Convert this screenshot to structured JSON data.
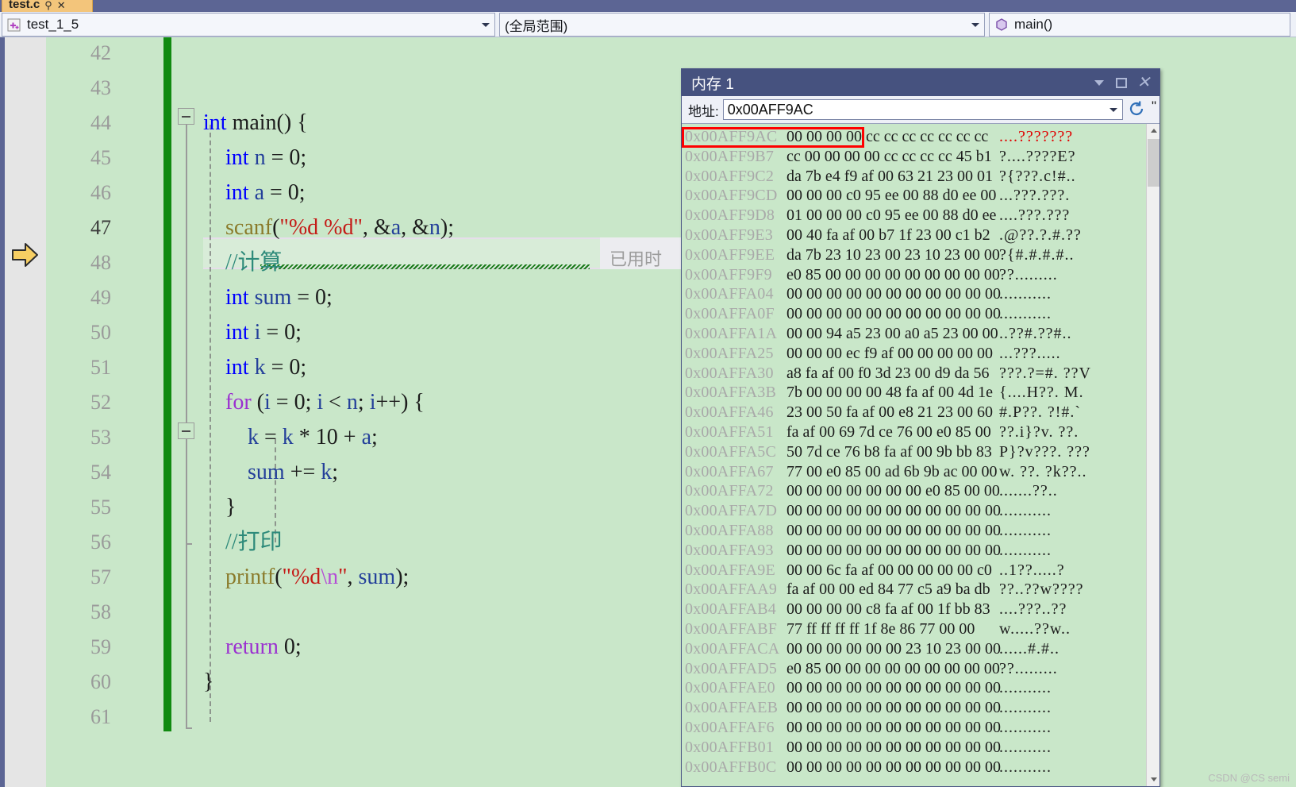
{
  "tab": {
    "title": "test.c",
    "pin_icon": "pin-icon",
    "close_icon": "close-icon"
  },
  "navbar": {
    "project_combo": {
      "value": "test_1_5",
      "icon": "project-icon"
    },
    "scope_combo": {
      "value": "(全局范围)"
    },
    "member_combo": {
      "value": "main()",
      "icon": "method-icon"
    }
  },
  "editor": {
    "current_line": 47,
    "first_line": 42,
    "elapsed_text": "已用时",
    "lines": [
      {
        "n": 42,
        "tokens": []
      },
      {
        "n": 43,
        "tokens": []
      },
      {
        "n": 44,
        "tokens": [
          {
            "t": "int ",
            "c": "kw"
          },
          {
            "t": "main() {",
            "c": "plain"
          }
        ]
      },
      {
        "n": 45,
        "tokens": [
          {
            "t": "    ",
            "c": "plain"
          },
          {
            "t": "int ",
            "c": "kw"
          },
          {
            "t": "n ",
            "c": "var"
          },
          {
            "t": "= ",
            "c": "plain"
          },
          {
            "t": "0",
            "c": "num"
          },
          {
            "t": ";",
            "c": "plain"
          }
        ]
      },
      {
        "n": 46,
        "tokens": [
          {
            "t": "    ",
            "c": "plain"
          },
          {
            "t": "int ",
            "c": "kw"
          },
          {
            "t": "a ",
            "c": "var"
          },
          {
            "t": "= ",
            "c": "plain"
          },
          {
            "t": "0",
            "c": "num"
          },
          {
            "t": ";",
            "c": "plain"
          }
        ]
      },
      {
        "n": 47,
        "tokens": [
          {
            "t": "    ",
            "c": "plain"
          },
          {
            "t": "scanf",
            "c": "fn"
          },
          {
            "t": "(",
            "c": "plain"
          },
          {
            "t": "\"%d %d\"",
            "c": "str"
          },
          {
            "t": ", &",
            "c": "plain"
          },
          {
            "t": "a",
            "c": "var"
          },
          {
            "t": ", &",
            "c": "plain"
          },
          {
            "t": "n",
            "c": "var"
          },
          {
            "t": ");",
            "c": "plain"
          }
        ]
      },
      {
        "n": 48,
        "tokens": [
          {
            "t": "    ",
            "c": "plain"
          },
          {
            "t": "//计算",
            "c": "cmt"
          }
        ]
      },
      {
        "n": 49,
        "tokens": [
          {
            "t": "    ",
            "c": "plain"
          },
          {
            "t": "int ",
            "c": "kw"
          },
          {
            "t": "sum ",
            "c": "var"
          },
          {
            "t": "= ",
            "c": "plain"
          },
          {
            "t": "0",
            "c": "num"
          },
          {
            "t": ";",
            "c": "plain"
          }
        ]
      },
      {
        "n": 50,
        "tokens": [
          {
            "t": "    ",
            "c": "plain"
          },
          {
            "t": "int ",
            "c": "kw"
          },
          {
            "t": "i ",
            "c": "var"
          },
          {
            "t": "= ",
            "c": "plain"
          },
          {
            "t": "0",
            "c": "num"
          },
          {
            "t": ";",
            "c": "plain"
          }
        ]
      },
      {
        "n": 51,
        "tokens": [
          {
            "t": "    ",
            "c": "plain"
          },
          {
            "t": "int ",
            "c": "kw"
          },
          {
            "t": "k ",
            "c": "var"
          },
          {
            "t": "= ",
            "c": "plain"
          },
          {
            "t": "0",
            "c": "num"
          },
          {
            "t": ";",
            "c": "plain"
          }
        ]
      },
      {
        "n": 52,
        "tokens": [
          {
            "t": "    ",
            "c": "plain"
          },
          {
            "t": "for ",
            "c": "kw2"
          },
          {
            "t": "(",
            "c": "plain"
          },
          {
            "t": "i ",
            "c": "var"
          },
          {
            "t": "= ",
            "c": "plain"
          },
          {
            "t": "0",
            "c": "num"
          },
          {
            "t": "; ",
            "c": "plain"
          },
          {
            "t": "i ",
            "c": "var"
          },
          {
            "t": "< ",
            "c": "plain"
          },
          {
            "t": "n",
            "c": "var"
          },
          {
            "t": "; ",
            "c": "plain"
          },
          {
            "t": "i",
            "c": "var"
          },
          {
            "t": "++) {",
            "c": "plain"
          }
        ]
      },
      {
        "n": 53,
        "tokens": [
          {
            "t": "        ",
            "c": "plain"
          },
          {
            "t": "k ",
            "c": "var"
          },
          {
            "t": "= ",
            "c": "plain"
          },
          {
            "t": "k ",
            "c": "var"
          },
          {
            "t": "* ",
            "c": "plain"
          },
          {
            "t": "10 ",
            "c": "num"
          },
          {
            "t": "+ ",
            "c": "plain"
          },
          {
            "t": "a",
            "c": "var"
          },
          {
            "t": ";",
            "c": "plain"
          }
        ]
      },
      {
        "n": 54,
        "tokens": [
          {
            "t": "        ",
            "c": "plain"
          },
          {
            "t": "sum ",
            "c": "var"
          },
          {
            "t": "+= ",
            "c": "plain"
          },
          {
            "t": "k",
            "c": "var"
          },
          {
            "t": ";",
            "c": "plain"
          }
        ]
      },
      {
        "n": 55,
        "tokens": [
          {
            "t": "    }",
            "c": "plain"
          }
        ]
      },
      {
        "n": 56,
        "tokens": [
          {
            "t": "    ",
            "c": "plain"
          },
          {
            "t": "//打印",
            "c": "cmt"
          }
        ]
      },
      {
        "n": 57,
        "tokens": [
          {
            "t": "    ",
            "c": "plain"
          },
          {
            "t": "printf",
            "c": "fn"
          },
          {
            "t": "(",
            "c": "plain"
          },
          {
            "t": "\"%d",
            "c": "str"
          },
          {
            "t": "\\n",
            "c": "esc"
          },
          {
            "t": "\"",
            "c": "str"
          },
          {
            "t": ", ",
            "c": "plain"
          },
          {
            "t": "sum",
            "c": "var"
          },
          {
            "t": ");",
            "c": "plain"
          }
        ]
      },
      {
        "n": 58,
        "tokens": []
      },
      {
        "n": 59,
        "tokens": [
          {
            "t": "    ",
            "c": "plain"
          },
          {
            "t": "return ",
            "c": "kw2"
          },
          {
            "t": "0",
            "c": "num"
          },
          {
            "t": ";",
            "c": "plain"
          }
        ]
      },
      {
        "n": 60,
        "tokens": [
          {
            "t": "}",
            "c": "plain"
          }
        ]
      },
      {
        "n": 61,
        "tokens": []
      }
    ]
  },
  "memory_window": {
    "title": "内存 1",
    "address_label": "地址:",
    "address_value": "0x00AFF9AC",
    "refresh_icon": "refresh-icon",
    "overflow_icon": "toolbar-overflow-icon",
    "minimize_icon": "window-menu-chevron-icon",
    "maximize_icon": "maximize-icon",
    "close_icon": "close-icon",
    "highlight_color": "#ff0000",
    "rows": [
      {
        "addr": "0x00AFF9AC",
        "hexA": "00 00 00 00",
        "hexB": "cc cc cc cc cc cc cc",
        "ascii": "....???????",
        "ascii_red": true
      },
      {
        "addr": "0x00AFF9B7",
        "hex": "cc 00 00 00 00 cc cc cc cc 45 b1",
        "ascii": "?....????E?"
      },
      {
        "addr": "0x00AFF9C2",
        "hex": "da 7b e4 f9 af 00 63 21 23 00 01",
        "ascii": "?{???.c!#.."
      },
      {
        "addr": "0x00AFF9CD",
        "hex": "00 00 00 c0 95 ee 00 88 d0 ee 00",
        "ascii": "...???.???."
      },
      {
        "addr": "0x00AFF9D8",
        "hex": "01 00 00 00 c0 95 ee 00 88 d0 ee",
        "ascii": "....???.???"
      },
      {
        "addr": "0x00AFF9E3",
        "hex": "00 40 fa af 00 b7 1f 23 00 c1 b2",
        "ascii": ".@??.?.#.??"
      },
      {
        "addr": "0x00AFF9EE",
        "hex": "da 7b 23 10 23 00 23 10 23 00 00",
        "ascii": "?{#.#.#.#.."
      },
      {
        "addr": "0x00AFF9F9",
        "hex": "e0 85 00 00 00 00 00 00 00 00 00",
        "ascii": "??........."
      },
      {
        "addr": "0x00AFFA04",
        "hex": "00 00 00 00 00 00 00 00 00 00 00",
        "ascii": "..........."
      },
      {
        "addr": "0x00AFFA0F",
        "hex": "00 00 00 00 00 00 00 00 00 00 00",
        "ascii": "..........."
      },
      {
        "addr": "0x00AFFA1A",
        "hex": "00 00 94 a5 23 00 a0 a5 23 00 00",
        "ascii": "..??#.??#.."
      },
      {
        "addr": "0x00AFFA25",
        "hex": "00 00 00 ec f9 af 00 00 00 00 00",
        "ascii": "...???....."
      },
      {
        "addr": "0x00AFFA30",
        "hex": "a8 fa af 00 f0 3d 23 00 d9 da 56",
        "ascii": "???.?=#. ??V"
      },
      {
        "addr": "0x00AFFA3B",
        "hex": "7b 00 00 00 00 48 fa af 00 4d 1e",
        "ascii": "{....H??. M."
      },
      {
        "addr": "0x00AFFA46",
        "hex": "23 00 50 fa af 00 e8 21 23 00 60",
        "ascii": "#.P??. ?!#.`"
      },
      {
        "addr": "0x00AFFA51",
        "hex": "fa af 00 69 7d ce 76 00 e0 85 00",
        "ascii": "??.i}?v. ??."
      },
      {
        "addr": "0x00AFFA5C",
        "hex": "50 7d ce 76 b8 fa af 00 9b bb 83",
        "ascii": "P}?v???. ???"
      },
      {
        "addr": "0x00AFFA67",
        "hex": "77 00 e0 85 00 ad 6b 9b ac 00 00",
        "ascii": "w. ??. ?k??.."
      },
      {
        "addr": "0x00AFFA72",
        "hex": "00 00 00 00 00 00 00 e0 85 00 00",
        "ascii": ".......??.."
      },
      {
        "addr": "0x00AFFA7D",
        "hex": "00 00 00 00 00 00 00 00 00 00 00",
        "ascii": "..........."
      },
      {
        "addr": "0x00AFFA88",
        "hex": "00 00 00 00 00 00 00 00 00 00 00",
        "ascii": "..........."
      },
      {
        "addr": "0x00AFFA93",
        "hex": "00 00 00 00 00 00 00 00 00 00 00",
        "ascii": "..........."
      },
      {
        "addr": "0x00AFFA9E",
        "hex": "00 00 6c fa af 00 00 00 00 00 c0",
        "ascii": "..1??.....?"
      },
      {
        "addr": "0x00AFFAA9",
        "hex": "fa af 00 00 ed 84 77 c5 a9 ba db",
        "ascii": "??..??w????"
      },
      {
        "addr": "0x00AFFAB4",
        "hex": "00 00 00 00 c8 fa af 00 1f bb 83",
        "ascii": "....???..??"
      },
      {
        "addr": "0x00AFFABF",
        "hex": "77 ff ff ff ff 1f 8e 86 77 00 00",
        "ascii": "w.....??w.."
      },
      {
        "addr": "0x00AFFACA",
        "hex": "00 00 00 00 00 00 23 10 23 00 00",
        "ascii": "......#.#.."
      },
      {
        "addr": "0x00AFFAD5",
        "hex": "e0 85 00 00 00 00 00 00 00 00 00",
        "ascii": "??........."
      },
      {
        "addr": "0x00AFFAE0",
        "hex": "00 00 00 00 00 00 00 00 00 00 00",
        "ascii": "..........."
      },
      {
        "addr": "0x00AFFAEB",
        "hex": "00 00 00 00 00 00 00 00 00 00 00",
        "ascii": "..........."
      },
      {
        "addr": "0x00AFFAF6",
        "hex": "00 00 00 00 00 00 00 00 00 00 00",
        "ascii": "..........."
      },
      {
        "addr": "0x00AFFB01",
        "hex": "00 00 00 00 00 00 00 00 00 00 00",
        "ascii": "..........."
      },
      {
        "addr": "0x00AFFB0C",
        "hex": "00 00 00 00 00 00 00 00 00 00 00",
        "ascii": "..........."
      }
    ]
  },
  "watermark": "CSDN @CS semi"
}
